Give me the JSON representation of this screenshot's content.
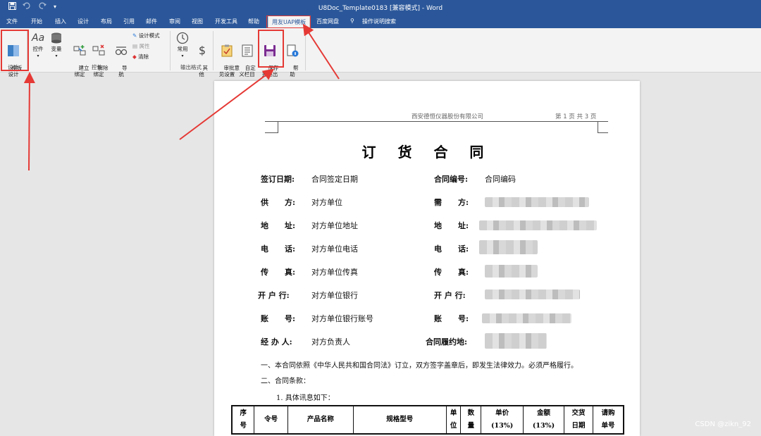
{
  "window": {
    "title": "U8Doc_Template0183 [兼容模式] - Word"
  },
  "quick_access": [
    "save-icon",
    "undo-icon",
    "redo-icon",
    "customize-icon"
  ],
  "tabs": [
    "文件",
    "开始",
    "插入",
    "设计",
    "布局",
    "引用",
    "邮件",
    "审阅",
    "视图",
    "开发工具",
    "帮助",
    "用友UAP模板",
    "百度网盘",
    "操作说明搜索"
  ],
  "active_tab": "用友UAP模板",
  "ribbon": {
    "template_design": "模板\n设计",
    "group_design": "设计",
    "control": "控件",
    "variable": "变量",
    "bind": "建立\n绑定",
    "unbind": "解除\n绑定",
    "navigate": "导\n航",
    "design_mode": "设计模式",
    "properties": "属性",
    "clear": "清除",
    "group_control": "控件",
    "common": "常用",
    "other": "其\n他",
    "group_output": "输出格式",
    "review_setup": "审批意\n见设置",
    "custom_bar": "自定\n义栏目",
    "save_exit": "保存\n并退出",
    "help": "帮\n助"
  },
  "document": {
    "header_company": "西安德恒仪器股份有限公司",
    "header_page": "第 1 页  共 3 页",
    "title": "订 货 合 同",
    "fields_left": [
      {
        "label": "签订日期:",
        "value": "合同签定日期"
      },
      {
        "label": "供      方:",
        "value": "对方单位"
      },
      {
        "label": "地      址:",
        "value": "对方单位地址"
      },
      {
        "label": "电      话:",
        "value": "对方单位电话"
      },
      {
        "label": "传      真:",
        "value": "对方单位传真"
      },
      {
        "label": "开 户 行:",
        "value": "对方单位银行"
      },
      {
        "label": "账      号:",
        "value": "对方单位银行账号"
      },
      {
        "label": "经 办 人:",
        "value": "对方负责人"
      }
    ],
    "fields_right": [
      {
        "label": "合同编号:",
        "value": "合同编码"
      },
      {
        "label": "需      方:",
        "value": ""
      },
      {
        "label": "地      址:",
        "value": ""
      },
      {
        "label": "电      话:",
        "value": ""
      },
      {
        "label": "传      真:",
        "value": ""
      },
      {
        "label": "开 户 行:",
        "value": ""
      },
      {
        "label": "账      号:",
        "value": ""
      },
      {
        "label": "合同履约地:",
        "value": ""
      }
    ],
    "clause1": "一、本合同依照《中华人民共和国合同法》订立，双方签字盖章后，即发生法律效力。必须严格履行。",
    "clause2": "二、合同条款：",
    "clause2_1": "1.  具体讯息如下：",
    "table_headers": [
      "序\n号",
      "令号",
      "产品名称",
      "规格型号",
      "单\n位",
      "数\n量",
      "单价\n(13%)",
      "金额\n(13%)",
      "交货\n日期",
      "请购\n单号"
    ]
  },
  "watermark": "CSDN @zikn_92",
  "colors": {
    "accent": "#2b579a",
    "highlight": "#e53935"
  }
}
